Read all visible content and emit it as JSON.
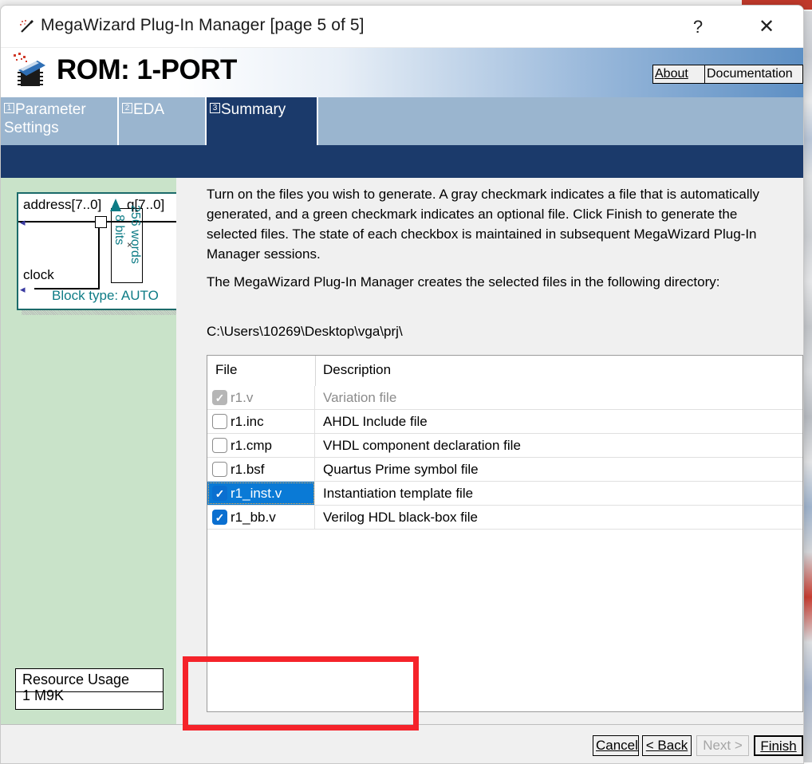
{
  "window": {
    "title": "MegaWizard Plug-In Manager [page 5 of 5]",
    "wand_icon": "magic-wand-icon",
    "help_label": "?",
    "close_label": "✕"
  },
  "banner": {
    "title": "ROM: 1-PORT",
    "icon": "chip-wizard-icon",
    "about_label": "About",
    "documentation_label": "Documentation",
    "gradient_from": "#ffffff",
    "gradient_to": "#5d8fc4"
  },
  "tabs": [
    {
      "num": "1",
      "label": "Parameter Settings",
      "active": false
    },
    {
      "num": "2",
      "label": "EDA",
      "active": false
    },
    {
      "num": "3",
      "label": "Summary",
      "active": true
    }
  ],
  "tab_colors": {
    "inactive_bg": "#9ab5cf",
    "active_bg": "#1b3a6b",
    "text": "#ffffff"
  },
  "preview": {
    "panel_color": "#c9e3c9",
    "symbol": {
      "port_address": "address[7..0]",
      "port_q": "q[7..0]",
      "port_clock": "clock",
      "mem_width": "8 bits",
      "mem_depth": "256 words",
      "mem_times": "×",
      "block_type": "Block type: AUTO",
      "accent_color": "#0e7c86"
    },
    "resource": {
      "title": "Resource Usage",
      "value": "1 M9K"
    }
  },
  "content": {
    "paragraph_1": "Turn on the files you wish to generate. A gray checkmark indicates a file that is automatically generated, and a green checkmark indicates an optional file. Click Finish to generate the selected files. The state of each checkbox is maintained in subsequent MegaWizard Plug-In Manager sessions.",
    "paragraph_2": "The MegaWizard Plug-In Manager creates the selected files in the following directory:",
    "directory": "C:\\Users\\10269\\Desktop\\vga\\prj\\"
  },
  "file_table": {
    "columns": [
      "File",
      "Description"
    ],
    "rows": [
      {
        "file": "r1.v",
        "description": "Variation file",
        "checkbox": "gray",
        "checked": true,
        "selected": false
      },
      {
        "file": "r1.inc",
        "description": "AHDL Include file",
        "checkbox": "empty",
        "checked": false,
        "selected": false
      },
      {
        "file": "r1.cmp",
        "description": "VHDL component declaration file",
        "checkbox": "empty",
        "checked": false,
        "selected": false
      },
      {
        "file": "r1.bsf",
        "description": "Quartus Prime symbol file",
        "checkbox": "empty",
        "checked": false,
        "selected": false
      },
      {
        "file": "r1_inst.v",
        "description": "Instantiation template file",
        "checkbox": "blue",
        "checked": true,
        "selected": true
      },
      {
        "file": "r1_bb.v",
        "description": "Verilog HDL black-box file",
        "checkbox": "blue",
        "checked": true,
        "selected": false
      }
    ],
    "selected_row_color": "#0a7ad6",
    "checked_color": "#0a6fd0"
  },
  "annotation": {
    "shape": "rectangle",
    "color": "#f5232a"
  },
  "footer": {
    "cancel_label": "Cancel",
    "back_label": "< Back",
    "next_label": "Next >",
    "finish_label": "Finish",
    "next_disabled": true
  }
}
